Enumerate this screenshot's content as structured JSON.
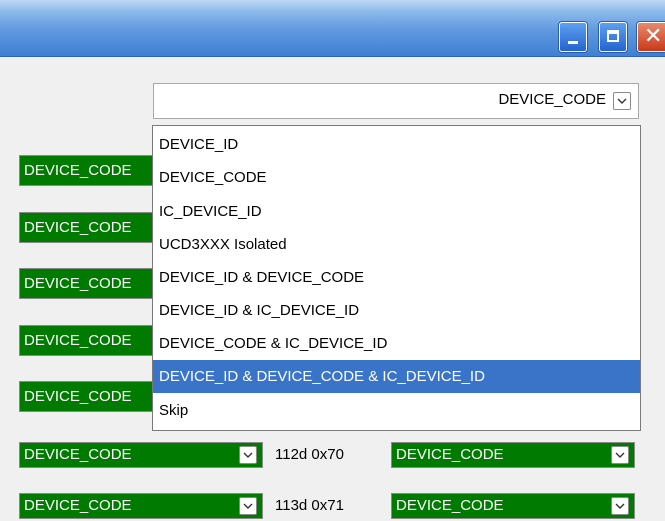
{
  "combo": {
    "selected_value": "DEVICE_CODE"
  },
  "dropdown": {
    "options": [
      "DEVICE_ID",
      "DEVICE_CODE",
      "IC_DEVICE_ID",
      "UCD3XXX Isolated",
      "DEVICE_ID & DEVICE_CODE",
      "DEVICE_ID & IC_DEVICE_ID",
      "DEVICE_CODE & IC_DEVICE_ID",
      "DEVICE_ID & DEVICE_CODE & IC_DEVICE_ID",
      "Skip"
    ],
    "selected_index": 7
  },
  "left_fields": [
    "DEVICE_CODE",
    "DEVICE_CODE",
    "DEVICE_CODE",
    "DEVICE_CODE",
    "DEVICE_CODE"
  ],
  "rows": [
    {
      "left_value": "DEVICE_CODE",
      "address": "112d 0x70",
      "right_value": "DEVICE_CODE"
    },
    {
      "left_value": "DEVICE_CODE",
      "address": "113d 0x71",
      "right_value": "DEVICE_CODE"
    }
  ],
  "colors": {
    "field_green": "#007a00",
    "selection_blue": "#3a74c9",
    "titlebar_blue": "#3f7fd3",
    "close_red": "#c9391a"
  },
  "icons": {
    "minimize": "minimize-icon",
    "maximize": "maximize-icon",
    "close": "close-icon",
    "dropdown_arrow": "chevron-down-icon"
  }
}
